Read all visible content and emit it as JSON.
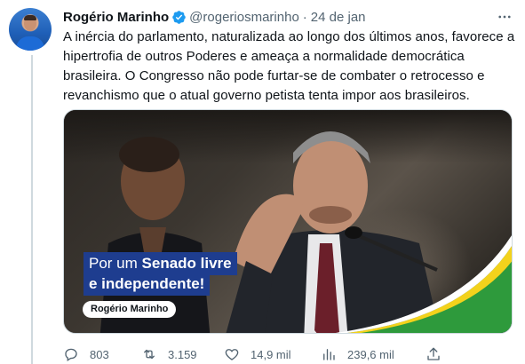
{
  "tweet": {
    "author_name": "Rogério Marinho",
    "handle": "@rogeriosmarinho",
    "separator": "·",
    "date": "24 de jan",
    "text_lines": [
      "A inércia do parlamento, naturalizada ao longo dos últimos anos, favorece a",
      "hipertrofia de outros Poderes e ameaça a normalidade democrática",
      "brasileira. O Congresso não pode furtar-se de combater o retrocesso e",
      "revanchismo que o atual governo petista tenta impor aos brasileiros."
    ],
    "verified_color": "#1d9bf0",
    "media": {
      "banner_line1_prefix": "Por um ",
      "banner_line1_bold": "Senado livre",
      "banner_line2": "e independente!",
      "name_tag": "Rogério Marinho",
      "banner_color": "#1e3d8f",
      "accent_green": "#2e9a3c",
      "accent_yellow": "#f3d21c"
    },
    "actions": {
      "replies": "803",
      "retweets": "3.159",
      "likes": "14,9 mil",
      "views": "239,6 mil"
    },
    "icons": [
      "verified-badge-icon",
      "more-icon",
      "reply-icon",
      "retweet-icon",
      "like-icon",
      "views-icon",
      "share-icon"
    ]
  }
}
